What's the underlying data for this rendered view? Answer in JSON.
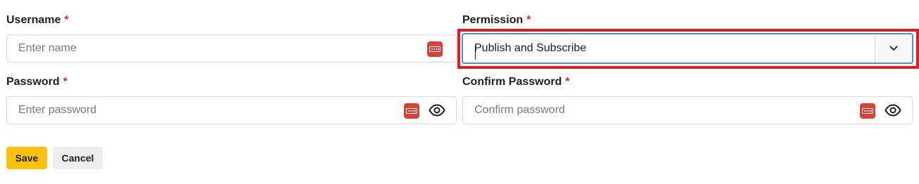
{
  "form": {
    "username": {
      "label": "Username",
      "required_mark": "*",
      "placeholder": "Enter name",
      "value": ""
    },
    "permission": {
      "label": "Permission",
      "required_mark": "*",
      "selected_value": "Publish and Subscribe",
      "focused": true,
      "highlighted": true
    },
    "password": {
      "label": "Password",
      "required_mark": "*",
      "placeholder": "Enter password",
      "value": ""
    },
    "confirm_password": {
      "label": "Confirm Password",
      "required_mark": "*",
      "placeholder": "Confirm password",
      "value": ""
    }
  },
  "actions": {
    "save_label": "Save",
    "cancel_label": "Cancel"
  },
  "icons": {
    "password_manager": "password-manager-icon",
    "visibility": "eye-icon",
    "dropdown": "chevron-down-icon"
  },
  "colors": {
    "required": "#d32f2f",
    "save_button": "#fcc10a",
    "cancel_button": "#eeeeee",
    "highlight_border": "#d81e26",
    "focus_border": "#4a90d9",
    "password_manager_icon": "#d9403a"
  }
}
